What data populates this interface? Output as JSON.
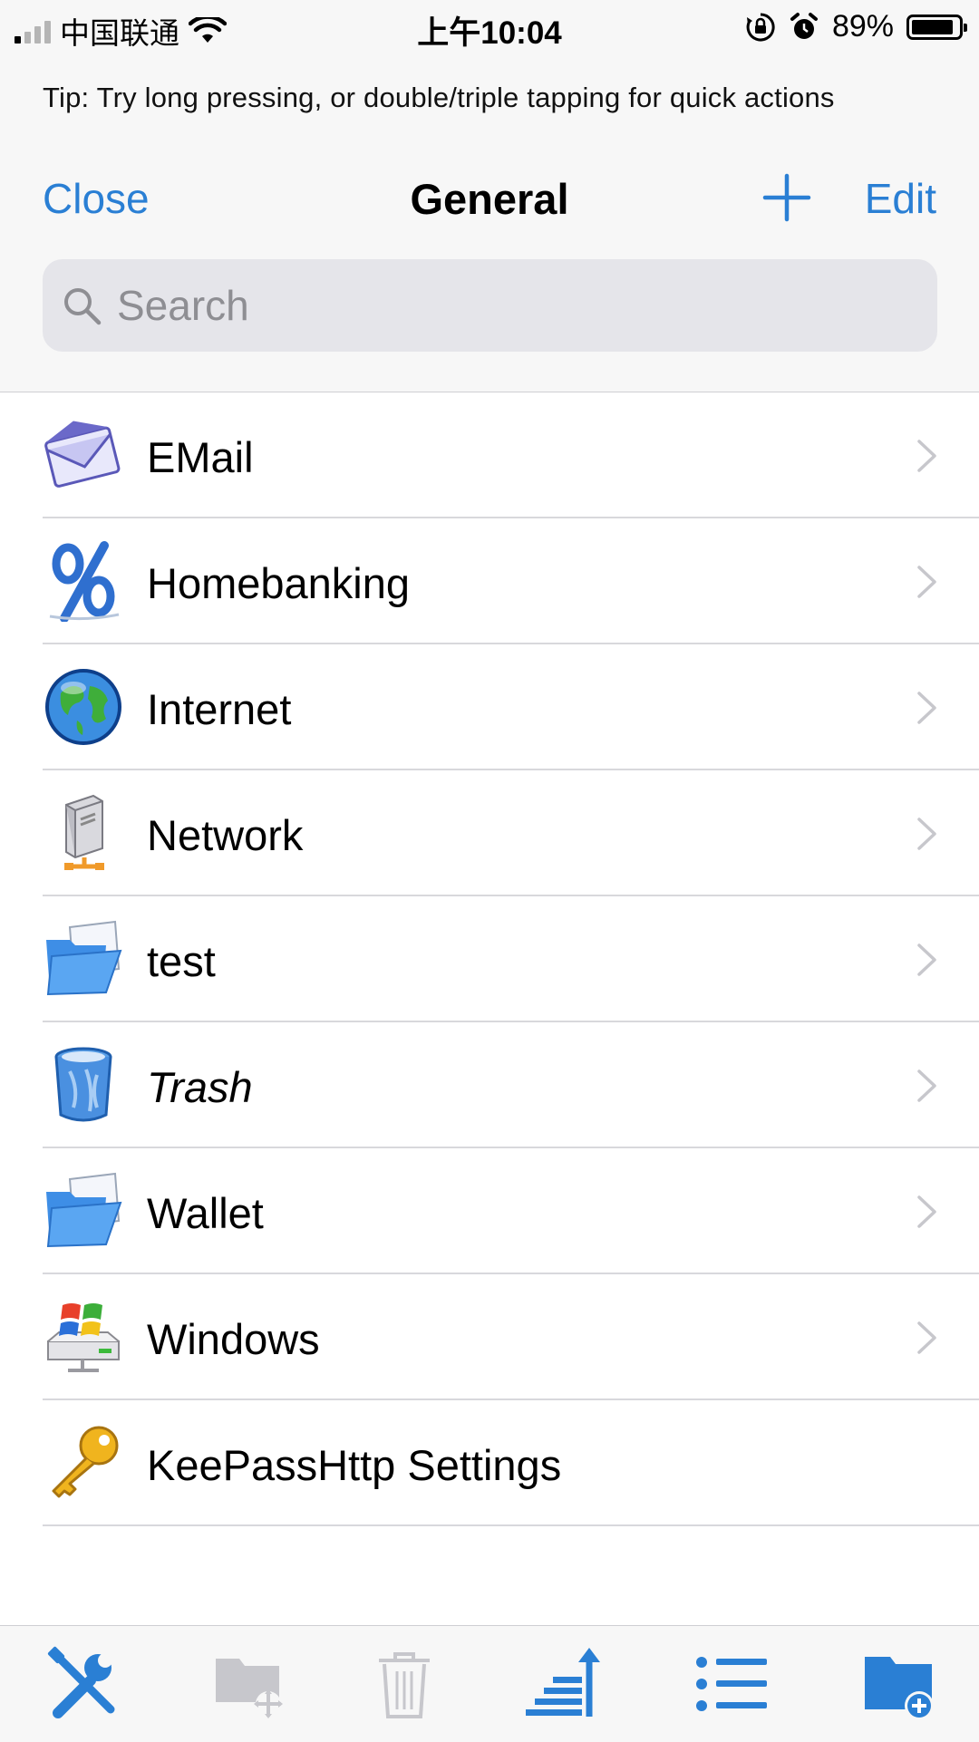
{
  "status_bar": {
    "carrier": "中国联通",
    "time": "上午10:04",
    "battery_percent": "89%",
    "battery_level": 0.89,
    "signal_bars_active": 1,
    "signal_bars_total": 4,
    "icons": [
      "signal-icon",
      "wifi-icon",
      "rotation-lock-icon",
      "alarm-icon",
      "battery-icon"
    ]
  },
  "tip": "Tip: Try long pressing, or double/triple tapping for quick actions",
  "nav": {
    "close_label": "Close",
    "title": "General",
    "add_icon": "plus-icon",
    "edit_label": "Edit"
  },
  "search": {
    "placeholder": "Search",
    "value": ""
  },
  "items": [
    {
      "label": "EMail",
      "icon": "envelope-icon",
      "chevron": true,
      "italic": false
    },
    {
      "label": "Homebanking",
      "icon": "percent-icon",
      "chevron": true,
      "italic": false
    },
    {
      "label": "Internet",
      "icon": "globe-icon",
      "chevron": true,
      "italic": false
    },
    {
      "label": "Network",
      "icon": "server-icon",
      "chevron": true,
      "italic": false
    },
    {
      "label": "test",
      "icon": "folder-icon",
      "chevron": true,
      "italic": false
    },
    {
      "label": "Trash",
      "icon": "trash-bin-icon",
      "chevron": true,
      "italic": true
    },
    {
      "label": "Wallet",
      "icon": "folder-icon",
      "chevron": true,
      "italic": false
    },
    {
      "label": "Windows",
      "icon": "windows-drive-icon",
      "chevron": true,
      "italic": false
    },
    {
      "label": "KeePassHttp Settings",
      "icon": "key-icon",
      "chevron": false,
      "italic": false
    }
  ],
  "toolbar": [
    {
      "icon": "tools-icon",
      "enabled": true
    },
    {
      "icon": "move-folder-icon",
      "enabled": false
    },
    {
      "icon": "trash-icon",
      "enabled": false
    },
    {
      "icon": "sort-icon",
      "enabled": true
    },
    {
      "icon": "list-icon",
      "enabled": true
    },
    {
      "icon": "new-folder-icon",
      "enabled": true
    }
  ],
  "colors": {
    "accent": "#2a7fd4",
    "disabled": "#c7c7cc",
    "separator": "#d8d8dc",
    "bar_background": "#f7f7f7",
    "search_background": "#e5e5ea"
  }
}
